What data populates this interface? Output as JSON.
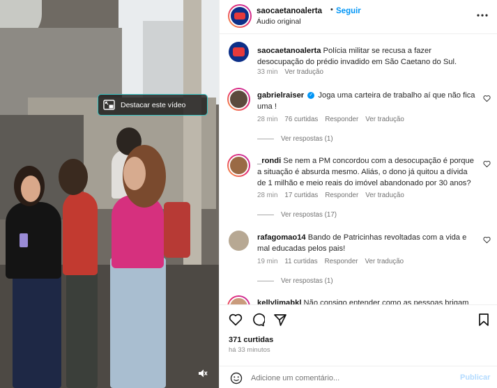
{
  "video": {
    "pip_label": "Destacar este vídeo"
  },
  "header": {
    "username": "saocaetanoalerta",
    "separator": "•",
    "follow_label": "Seguir",
    "audio_label": "Áudio original"
  },
  "caption": {
    "username": "saocaetanoalerta",
    "text": "Polícia militar se recusa a fazer desocupação do prédio invadido em São Caetano do Sul.",
    "time": "33 min",
    "translate_label": "Ver tradução"
  },
  "comments": [
    {
      "username": "gabrielraiser",
      "verified": true,
      "text": "Joga uma carteira de trabalho aí que não fica uma !",
      "time": "28 min",
      "likes": "76 curtidas",
      "reply_label": "Responder",
      "translate_label": "Ver tradução",
      "replies_label": "Ver respostas (1)"
    },
    {
      "username": "_rondi",
      "verified": false,
      "text": "Se nem a PM concordou com a desocupação é porque a situação é absurda mesmo. Aliás, o dono já quitou a dívida de 1 milhão e meio reais do imóvel abandonado por 30 anos?",
      "time": "28 min",
      "likes": "17 curtidas",
      "reply_label": "Responder",
      "translate_label": "Ver tradução",
      "replies_label": "Ver respostas (17)"
    },
    {
      "username": "rafagomao14",
      "verified": false,
      "text": "Bando de Patricinhas revoltadas com a vida e mal educadas pelos pais!",
      "time": "19 min",
      "likes": "11 curtidas",
      "reply_label": "Responder",
      "translate_label": "Ver tradução",
      "replies_label": "Ver respostas (1)"
    },
    {
      "username": "kellylimabkl",
      "verified": false,
      "text": "Não consigo entender como as pessoas brigam"
    }
  ],
  "footer": {
    "likes": "371 curtidas",
    "time_ago": "há 33 minutos",
    "comment_placeholder": "Adicione um comentário...",
    "publish_label": "Publicar"
  },
  "colors": {
    "accent": "#0095f6",
    "publish_disabled": "#b3dbff",
    "muted_text": "#8e8e8e",
    "pip_border": "#36c4c4",
    "brand_avatar": "#0c2f88"
  }
}
